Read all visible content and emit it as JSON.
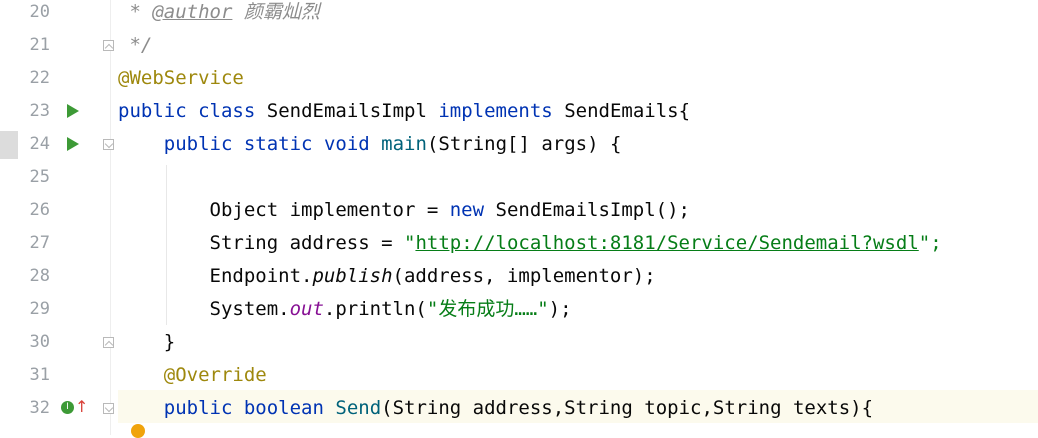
{
  "editor": {
    "lines": [
      {
        "num": "20",
        "text": " * @author 颜霸灿烈"
      },
      {
        "num": "21",
        "text": " */"
      },
      {
        "num": "22",
        "text": "@WebService"
      },
      {
        "num": "23",
        "text": "public class SendEmailsImpl implements SendEmails{"
      },
      {
        "num": "24",
        "text": "    public static void main(String[] args) {"
      },
      {
        "num": "25",
        "text": ""
      },
      {
        "num": "26",
        "text": "        Object implementor = new SendEmailsImpl();"
      },
      {
        "num": "27",
        "text": "        String address = \"http://localhost:8181/Service/Sendemail?wsdl\";"
      },
      {
        "num": "28",
        "text": "        Endpoint.publish(address, implementor);"
      },
      {
        "num": "29",
        "text": "        System.out.println(\"发布成功……\");"
      },
      {
        "num": "30",
        "text": "    }"
      },
      {
        "num": "31",
        "text": "    @Override"
      },
      {
        "num": "32",
        "text": "    public boolean Send(String address,String topic,String texts){"
      }
    ],
    "tokens": {
      "l20_star": " * ",
      "l20_tag": "@author",
      "l20_name": " 颜霸灿烈",
      "l21": " */",
      "l22": "@WebService",
      "kw_public": "public",
      "kw_class": "class",
      "cls_name": "SendEmailsImpl",
      "kw_implements": "implements",
      "iface": "SendEmails{",
      "kw_static": "static",
      "kw_void": "void",
      "fn_main": "main",
      "main_args": "(String[] args) {",
      "l26_a": "Object implementor = ",
      "kw_new": "new",
      "l26_b": " SendEmailsImpl();",
      "l27_a": "String address = ",
      "l27_q": "\"",
      "l27_url": "http://localhost:8181/Service/Sendemail?wsdl",
      "l27_end": "\";",
      "l28_a": "Endpoint.",
      "l28_pub": "publish",
      "l28_b": "(address, implementor);",
      "l29_a": "System.",
      "l29_out": "out",
      "l29_b": ".println(",
      "l29_str": "\"发布成功……\"",
      "l29_end": ");",
      "l30": "}",
      "l31": "@Override",
      "kw_boolean": "boolean",
      "fn_send": "Send",
      "send_args": "(String address,String topic,String texts){"
    },
    "override_badge": "I"
  }
}
